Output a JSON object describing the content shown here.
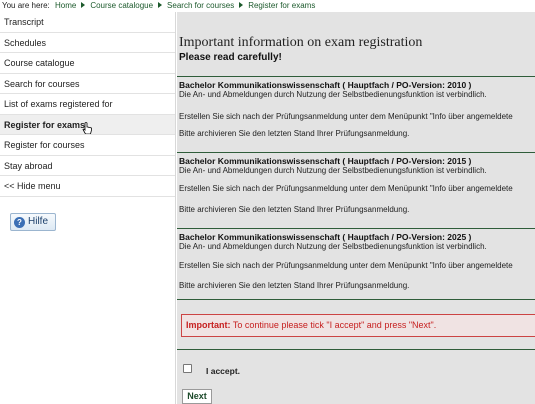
{
  "breadcrumb": {
    "prefix": "You are here:",
    "items": [
      "Home",
      "Course catalogue",
      "Search for courses",
      "Register for exams"
    ]
  },
  "sidebar": {
    "items": [
      {
        "label": "Transcript"
      },
      {
        "label": "Schedules"
      },
      {
        "label": "Course catalogue"
      },
      {
        "label": "Search for courses"
      },
      {
        "label": "List of exams registered for"
      },
      {
        "label": "Register for exams",
        "active": true
      },
      {
        "label": "Register for courses"
      },
      {
        "label": "Stay abroad"
      },
      {
        "label": "<< Hide menu"
      }
    ],
    "help_button": "Hilfe",
    "help_icon": "question-icon"
  },
  "main": {
    "title": "Important information on exam registration",
    "subtitle": "Please read carefully!",
    "sections": [
      {
        "title": "Bachelor Kommunikationswissenschaft ( Hauptfach / PO-Version: 2010 )",
        "line1": "Die An- und Abmeldungen durch Nutzung der Selbstbedienungsfunktion ist verbindlich.",
        "line2": "Erstellen Sie sich nach der Prüfungsanmeldung unter dem Menüpunkt \"Info über angemeldete",
        "line3": "Bitte archivieren Sie den letzten Stand Ihrer Prüfungsanmeldung."
      },
      {
        "title": "Bachelor Kommunikationswissenschaft ( Hauptfach / PO-Version: 2015 )",
        "line1": "Die An- und Abmeldungen durch Nutzung der Selbstbedienungsfunktion ist verbindlich.",
        "line2": "Erstellen Sie sich nach der Prüfungsanmeldung unter dem Menüpunkt \"Info über angemeldete",
        "line3": "Bitte archivieren Sie den letzten Stand Ihrer Prüfungsanmeldung."
      },
      {
        "title": "Bachelor Kommunikationswissenschaft ( Hauptfach / PO-Version: 2025 )",
        "line1": "Die An- und Abmeldungen durch Nutzung der Selbstbedienungsfunktion ist verbindlich.",
        "line2": "Erstellen Sie sich nach der Prüfungsanmeldung unter dem Menüpunkt \"Info über angemeldete",
        "line3": "Bitte archivieren Sie den letzten Stand Ihrer Prüfungsanmeldung."
      }
    ],
    "important_label": "Important:",
    "important_text": " To continue please tick \"I accept\" and press \"Next\".",
    "accept_label": "I accept.",
    "accept_checked": false,
    "next_button": "Next"
  },
  "colors": {
    "accent_green": "#1c5a2c",
    "divider_green": "#2f5d3a",
    "main_bg": "#e3e3e3",
    "warning_red": "#c62020"
  }
}
